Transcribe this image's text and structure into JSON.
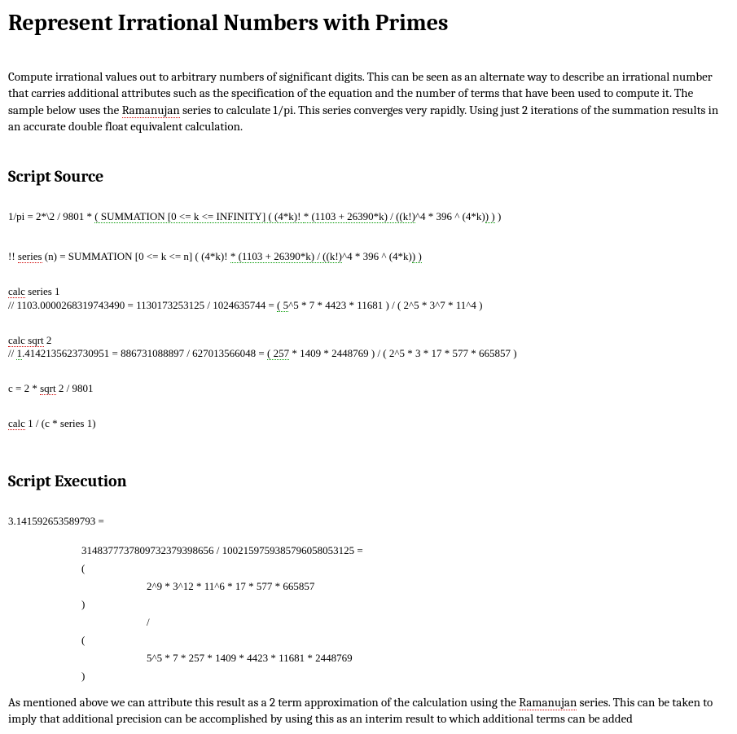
{
  "title": "Represent Irrational Numbers with Primes",
  "intro": {
    "p1a": "Compute irrational values out to arbitrary numbers of significant digits.  This can be seen as an alternate way to describe an irrational number that carries additional attributes such as the specification of the equation and the number of terms that have been used to compute it.  The sample below uses the ",
    "ramanujan": "Ramanujan",
    "p1b": " series to calculate 1/pi.  This series converges very rapidly.  Using just 2 iterations of the summation results in an accurate double float equivalent calculation."
  },
  "h2_source": "Script Source",
  "source": {
    "l1a": "1/pi = 2*\\2 / 9801 * ",
    "l1b": "( SUMMATION [0 <= k <= INFINITY] ( (4*k)! ",
    "l1c": "* (1103 + 26390*k) / ((k!)",
    "l1d": "^4 * 396 ^ (4*k)",
    "l1e": ") )",
    "l1f": " )",
    "l2a": "!! ",
    "l2b": "series",
    "l2c": " (n) = SUMMATION [0 <= k <= n] ( (4*k)! ",
    "l2d": "* (1103 + 26390*k) / ((k!)",
    "l2e": "^4 * 396 ^ (4*k)",
    "l2f": ") )",
    "l3a": "calc",
    "l3b": " series 1",
    "l3c": "// 1103.0000268319743490 = 1130173253125 / 1024635744 = ",
    "l3d": "( 5",
    "l3e": "^5 * 7 * 4423 * 11681 ) / ( 2^5 * 3^7 * 11^4 )",
    "l4a": "calc sqrt",
    "l4b": " 2",
    "l4c": "// ",
    "l4d": "1",
    "l4e": ".4142135623730951 = 886731088897 / 627013566048 = ",
    "l4f": "( 257",
    "l4g": " * 1409 * 2448769 ) / ( 2^5 * 3 * 17 * 577 * 665857 )",
    "l5a": "c = 2 * ",
    "l5b": "sqrt",
    "l5c": " 2 / 9801",
    "l6a": "calc",
    "l6b": " 1 / (c * series 1)"
  },
  "h2_exec": "Script Execution",
  "exec": {
    "result": "3.141592653589793 =",
    "frac": "31483777378097323793986​56 / 10021597593857960580531​25 =",
    "lp1": "(",
    "num": "2^9 * 3^12 * 11^6 * 17 * 577 * 665857",
    "rp1": ")",
    "slash": "/",
    "lp2": "(",
    "den": "5^5 * 7 * 257 * 1409 * 4423 * 11681 * 2448769",
    "rp2": ")"
  },
  "outro": {
    "a": "As mentioned above we can attribute this result as a 2 term approximation of the calculation using the ",
    "ramanujan": "Ramanujan",
    "b": " series.  This can be taken to imply that additional precision can be accomplished by using this as an interim result to which additional terms can be added"
  }
}
